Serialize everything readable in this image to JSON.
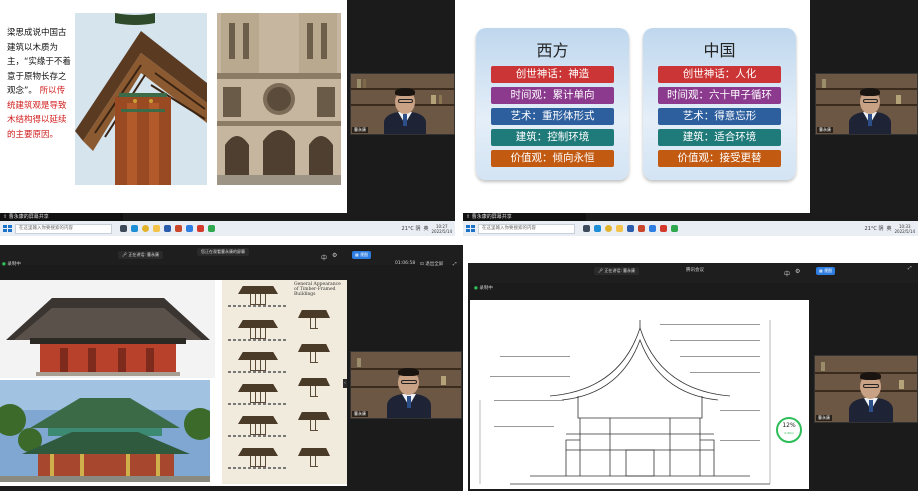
{
  "panels": {
    "top_left": {
      "slide_text": {
        "black": "梁思成说中国古建筑以木质为主，“实缘于不着意于原物长存之观念”。",
        "red": "所以传统建筑观是导致木结构得以延续的主要原因。"
      },
      "share_label": "曹永康的屏幕共享",
      "cam_name": "曹永康"
    },
    "top_right": {
      "share_label": "曹永康的屏幕共享",
      "cam_name": "曹永康",
      "west": {
        "title": "西方",
        "rows": [
          "创世神话：神造",
          "时间观：累计单向",
          "艺术：重形体形式",
          "建筑：控制环境",
          "价值观：倾向永恒"
        ]
      },
      "east": {
        "title": "中国",
        "rows": [
          "创世神话：人化",
          "时间观：六十甲子循环",
          "艺术：得意忘形",
          "建筑：适合环境",
          "价值观：接受更替"
        ]
      },
      "row_colors": [
        "#cc3536",
        "#8b3a8e",
        "#2d5f9e",
        "#1f7a7a",
        "#c25a12"
      ]
    },
    "bottom_left": {
      "speaker_pill": "正在讲话: 曹永康",
      "share_pill": "您正在观看曹永康的屏幕",
      "lang_button": "中",
      "view_button": "视图",
      "timer": "01:06:58",
      "exit_label": "退出全屏",
      "status": "录制中",
      "back_label": "结束演示",
      "blueprint_title": "General Appearance of Timber-Framed Buildings",
      "cam_name": "曹永康"
    },
    "bottom_right": {
      "speaker_pill": "正在讲话: 曹永康",
      "meeting_title": "腾讯会议",
      "lang_button": "中",
      "view_button": "视图",
      "status": "录制中",
      "cam_name": "曹永康",
      "gauge_value": "12%",
      "gauge_unit": "0.9K/s"
    }
  },
  "taskbar": {
    "search_placeholder": "在这里输入你要搜索的内容",
    "weather": "21°C 阴",
    "ime": "英",
    "left_time": "10:27",
    "left_date": "2022/5/14",
    "right_time": "10:33",
    "right_date": "2022/5/14"
  }
}
